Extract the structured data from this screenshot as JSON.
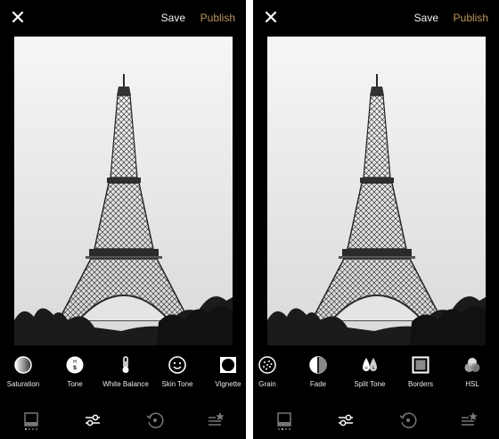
{
  "screens": [
    {
      "header": {
        "save_label": "Save",
        "publish_label": "Publish"
      },
      "tools": [
        {
          "label": "Saturation",
          "icon": "saturation-icon"
        },
        {
          "label": "Tone",
          "icon": "tone-icon"
        },
        {
          "label": "White Balance",
          "icon": "thermometer-icon"
        },
        {
          "label": "Skin Tone",
          "icon": "smiley-face-icon"
        },
        {
          "label": "Vignette",
          "icon": "vignette-icon"
        }
      ],
      "nav": [
        "presets-tab",
        "tools-tab",
        "history-tab",
        "recipes-tab"
      ],
      "active_nav": "tools-tab"
    },
    {
      "header": {
        "save_label": "Save",
        "publish_label": "Publish"
      },
      "tools": [
        {
          "label": "Grain",
          "icon": "grain-icon"
        },
        {
          "label": "Fade",
          "icon": "fade-icon"
        },
        {
          "label": "Split Tone",
          "icon": "split-tone-icon"
        },
        {
          "label": "Borders",
          "icon": "borders-icon"
        },
        {
          "label": "HSL",
          "icon": "hsl-icon"
        }
      ],
      "nav": [
        "presets-tab",
        "tools-tab",
        "history-tab",
        "recipes-tab"
      ],
      "active_nav": "tools-tab"
    }
  ],
  "colors": {
    "background": "#000000",
    "text": "#f2f2f2",
    "accent": "#b8965e",
    "inactive": "#777777"
  }
}
